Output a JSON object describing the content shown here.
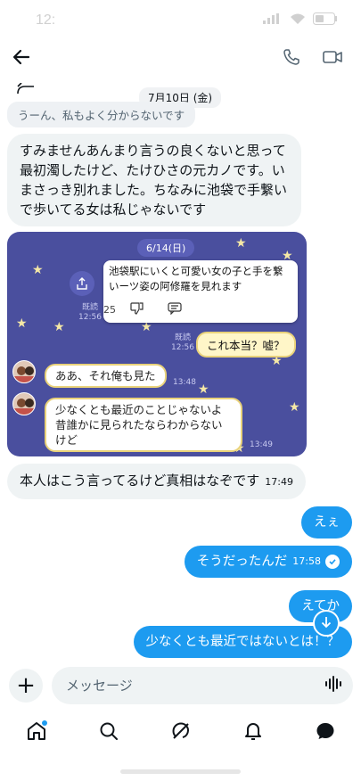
{
  "status": {
    "time": "12:",
    "battery_icon": "battery-icon",
    "wifi_icon": "wifi-icon"
  },
  "header": {
    "back_icon": "arrow-left-icon",
    "call_icon": "phone-icon",
    "video_icon": "video-icon"
  },
  "thread": {
    "date": "7月10日 (金)",
    "quoted_reply": "うーん、私もよく分からないです",
    "incoming_1": "すみませんあんまり言うの良くないと思って最初濁したけど、たけひさの元カノです。いまさっき別れました。ちなみに池袋で手繋いで歩いてる女は私じゃないです",
    "incoming_2": {
      "text": "本人はこう言ってるけど真相はなぞです",
      "time": "17:49"
    },
    "outgoing": [
      {
        "text": "えぇ"
      },
      {
        "text": "そうだったんだ",
        "time": "17:58"
      },
      {
        "text": "えてか"
      },
      {
        "text": "少なくとも最近ではないとは！？"
      }
    ]
  },
  "screenshot": {
    "date": "6/14(日)",
    "card_text": "池袋駅にいくと可愛い女の子と手を繋いーツ姿の阿修羅を見れます",
    "card_count": "25",
    "read_label_1": "既読",
    "read_time_1": "12:56",
    "yellow_bubble": "これ本当？嘘？",
    "read_label_2": "既読",
    "read_time_2": "12:56",
    "reply_1": "ああ、それ俺も見た",
    "time_1": "13:48",
    "reply_2": "少なくとも最近のことじゃないよ昔誰かに見られたならわからないけど",
    "time_2": "13:49"
  },
  "composer": {
    "placeholder": "メッセージ",
    "plus_label": "+"
  },
  "tabs": [
    "home-icon",
    "search-icon",
    "grok-icon",
    "bell-icon",
    "messages-icon"
  ],
  "colors": {
    "accent": "#1d9bf0",
    "bubble_in": "#eff3f4",
    "screenshot_bg": "#4a4f9e"
  }
}
